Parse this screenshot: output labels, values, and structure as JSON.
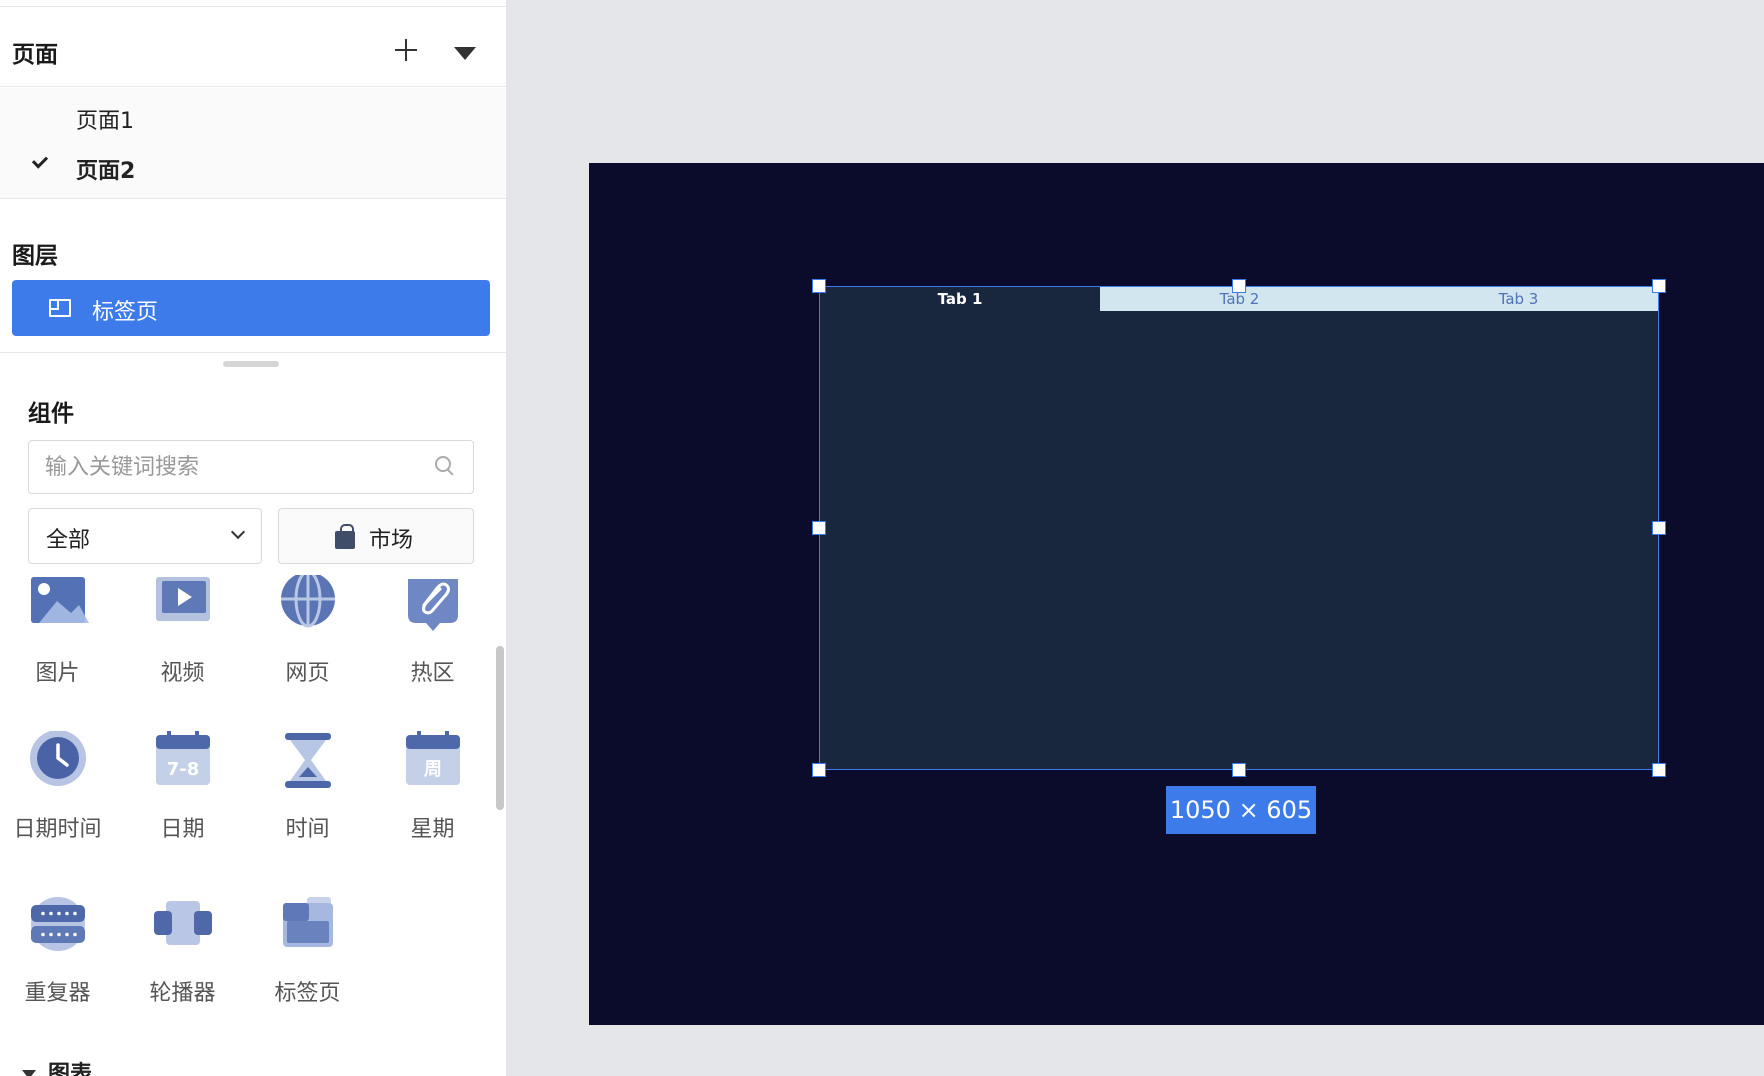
{
  "pages": {
    "title": "页面",
    "items": [
      {
        "label": "页面1",
        "active": false
      },
      {
        "label": "页面2",
        "active": true
      }
    ]
  },
  "layers": {
    "title": "图层",
    "items": [
      {
        "label": "标签页",
        "icon": "tabs-icon"
      }
    ]
  },
  "components": {
    "title": "组件",
    "search_placeholder": "输入关键词搜索",
    "category_value": "全部",
    "market_label": "市场",
    "items": [
      {
        "label": "图片",
        "icon": "image-icon"
      },
      {
        "label": "视频",
        "icon": "video-icon"
      },
      {
        "label": "网页",
        "icon": "globe-icon"
      },
      {
        "label": "热区",
        "icon": "hotspot-icon"
      },
      {
        "label": "日期时间",
        "icon": "clock-icon"
      },
      {
        "label": "日期",
        "icon": "calendar-date-icon",
        "glyph": "7-8"
      },
      {
        "label": "时间",
        "icon": "hourglass-icon"
      },
      {
        "label": "星期",
        "icon": "calendar-week-icon",
        "glyph": "周"
      },
      {
        "label": "重复器",
        "icon": "repeater-icon"
      },
      {
        "label": "轮播器",
        "icon": "carousel-icon"
      },
      {
        "label": "标签页",
        "icon": "tabs-icon"
      }
    ],
    "charts_section_label": "图表"
  },
  "canvas": {
    "background": "#0b0b2c",
    "tabs": [
      "Tab 1",
      "Tab 2",
      "Tab 3"
    ],
    "active_tab": "Tab 1",
    "size_label": "1050 × 605"
  },
  "colors": {
    "accent": "#3d7bea",
    "widget_bg": "#18273d",
    "inactive_tab_bg": "#d2e6f0"
  }
}
